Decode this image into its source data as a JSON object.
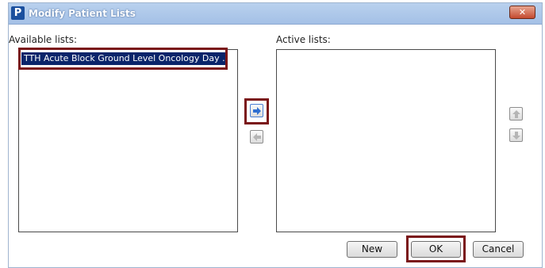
{
  "window": {
    "title": "Modify Patient Lists",
    "app_icon_letter": "P"
  },
  "available": {
    "label": "Available lists:",
    "items": [
      "TTH Acute Block Ground Level Oncology Day ..."
    ]
  },
  "active": {
    "label": "Active lists:",
    "items": []
  },
  "buttons": {
    "new": "New",
    "ok": "OK",
    "cancel": "Cancel"
  },
  "colors": {
    "selection": "#0a246a",
    "highlight_box": "#7a1518",
    "arrow_active": "#2f6fd0"
  }
}
